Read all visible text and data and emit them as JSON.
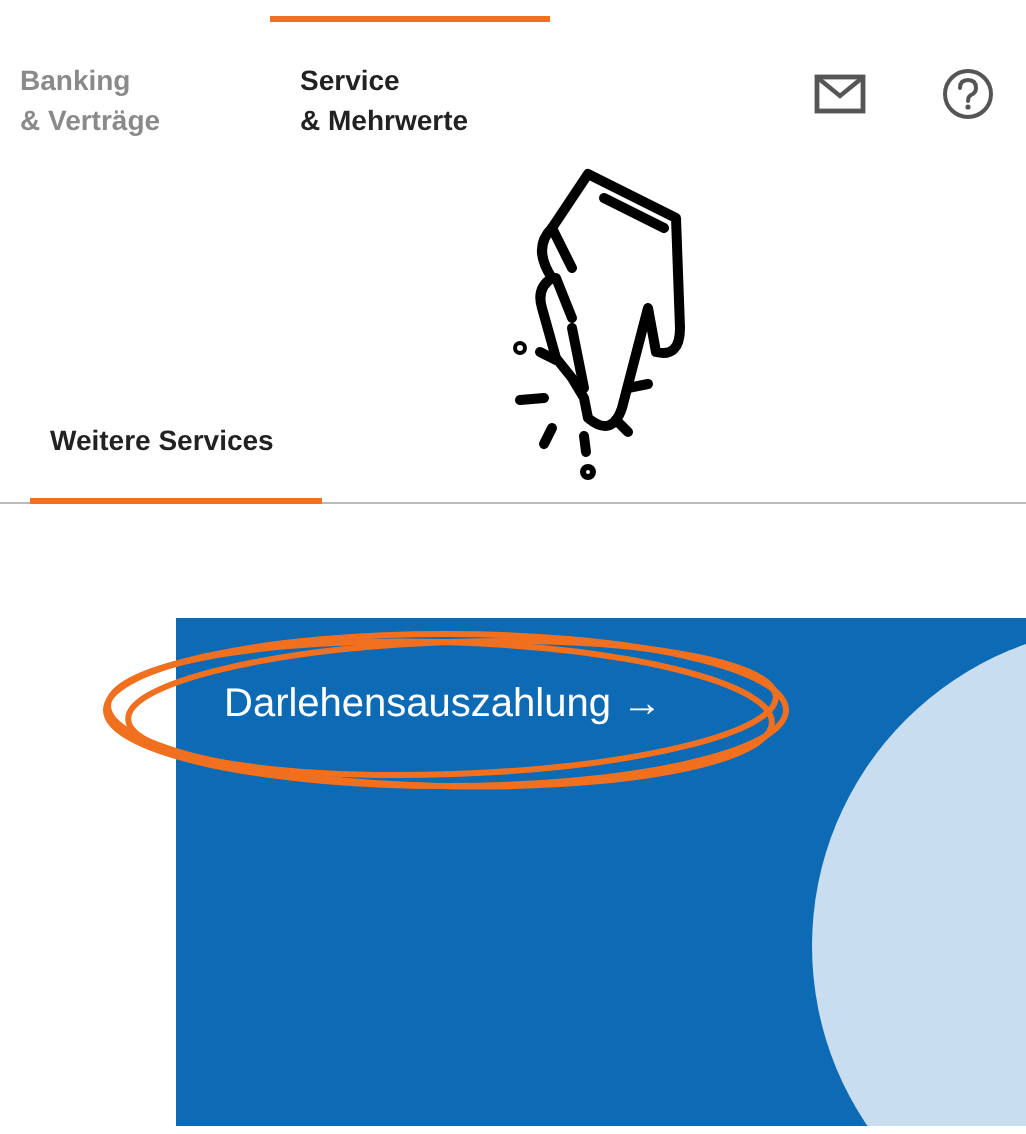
{
  "tabs": [
    {
      "label": "Banking\n& Verträge",
      "selected": false
    },
    {
      "label": "Service\n& Mehrwerte",
      "selected": true
    }
  ],
  "subtabs": [
    {
      "label": "Weitere Services",
      "selected": true
    }
  ],
  "card": {
    "link": "Darlehensauszahlung →"
  }
}
